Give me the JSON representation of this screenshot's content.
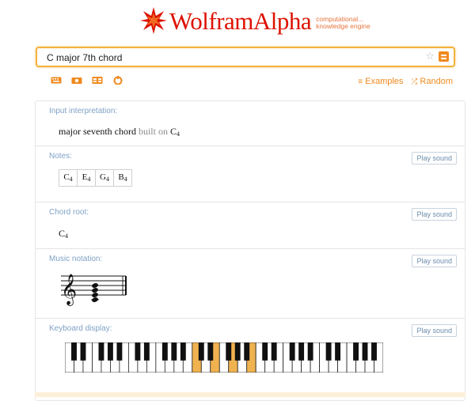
{
  "brand": {
    "name": "WolframAlpha",
    "tagline_line1": "computational...",
    "tagline_line2": "knowledge engine",
    "color": "#dd1100"
  },
  "search": {
    "value": "C major 7th chord",
    "accent": "#f3b13c"
  },
  "toolbar": {
    "icons": [
      "keyboard-icon",
      "camera-icon",
      "grid-icon",
      "random-shuffle-icon"
    ],
    "examples_label": "Examples",
    "random_label": "Random"
  },
  "pods": {
    "interpretation": {
      "title": "Input interpretation:",
      "main": "major seventh chord",
      "built_on": "built on",
      "root_note": "C",
      "root_octave": "4"
    },
    "notes": {
      "title": "Notes:",
      "button": "Play sound",
      "items": [
        {
          "note": "C",
          "octave": "4"
        },
        {
          "note": "E",
          "octave": "4"
        },
        {
          "note": "G",
          "octave": "4"
        },
        {
          "note": "B",
          "octave": "4"
        }
      ]
    },
    "chord_root": {
      "title": "Chord root:",
      "button": "Play sound",
      "note": "C",
      "octave": "4"
    },
    "music_notation": {
      "title": "Music notation:",
      "button": "Play sound"
    },
    "keyboard": {
      "title": "Keyboard display:",
      "button": "Play sound",
      "white_key_count": 35,
      "highlighted_white_keys": [
        14,
        16,
        18,
        20
      ],
      "highlight_color": "#f0b24f"
    }
  }
}
